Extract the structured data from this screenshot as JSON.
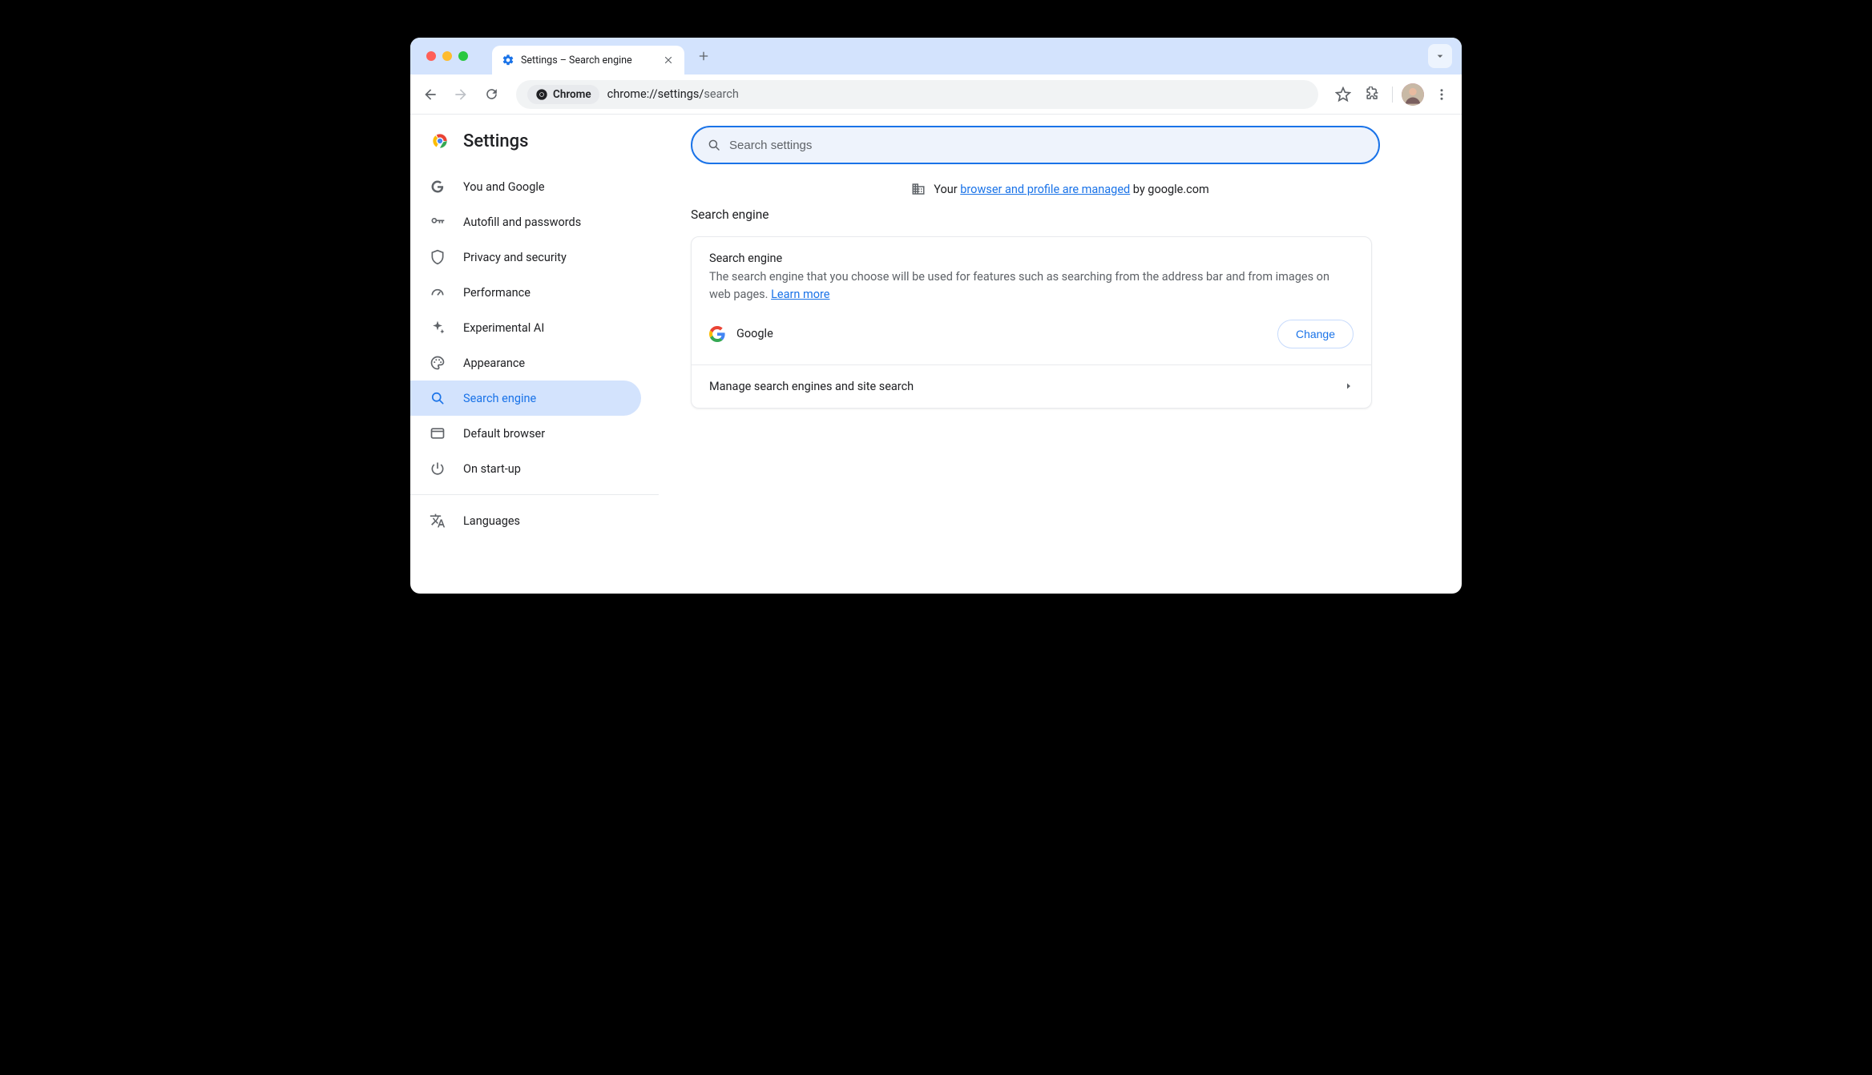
{
  "tab": {
    "title": "Settings – Search engine"
  },
  "omnibox": {
    "chip_label": "Chrome",
    "url_scheme": "chrome://settings/",
    "url_path": "search"
  },
  "sidebar": {
    "title": "Settings",
    "items": [
      {
        "label": "You and Google"
      },
      {
        "label": "Autofill and passwords"
      },
      {
        "label": "Privacy and security"
      },
      {
        "label": "Performance"
      },
      {
        "label": "Experimental AI"
      },
      {
        "label": "Appearance"
      },
      {
        "label": "Search engine"
      },
      {
        "label": "Default browser"
      },
      {
        "label": "On start-up"
      }
    ],
    "items2": [
      {
        "label": "Languages"
      }
    ]
  },
  "search": {
    "placeholder": "Search settings"
  },
  "managed": {
    "prefix": "Your ",
    "link": "browser and profile are managed",
    "suffix": " by google.com"
  },
  "section": {
    "title": "Search engine"
  },
  "card": {
    "title": "Search engine",
    "desc_a": "The search engine that you choose will be used for features such as searching from the address bar and from images on web pages. ",
    "learn_more": "Learn more",
    "engine_name": "Google",
    "change_label": "Change",
    "manage_row": "Manage search engines and site search"
  }
}
